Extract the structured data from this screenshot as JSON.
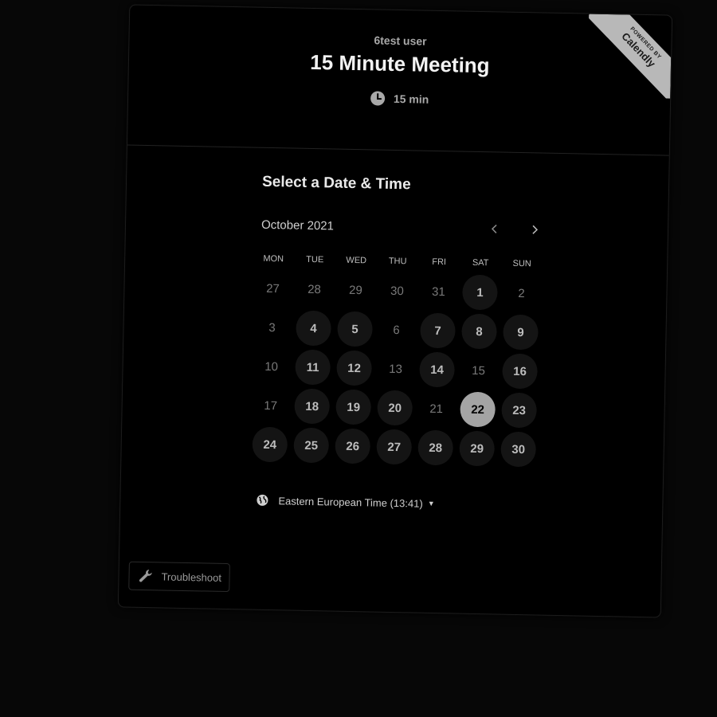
{
  "ribbon": {
    "small": "POWERED BY",
    "brand": "Calendly"
  },
  "header": {
    "owner": "6test user",
    "title": "15 Minute Meeting",
    "duration": "15 min",
    "duration_icon": "clock-icon"
  },
  "section_title": "Select a Date & Time",
  "calendar": {
    "month": "October 2021",
    "prev_icon": "chevron-left-icon",
    "next_icon": "chevron-right-icon",
    "weekdays": [
      "MON",
      "TUE",
      "WED",
      "THU",
      "FRI",
      "SAT",
      "SUN"
    ],
    "weeks": [
      [
        {
          "label": "27",
          "state": "other"
        },
        {
          "label": "28",
          "state": "other"
        },
        {
          "label": "29",
          "state": "other"
        },
        {
          "label": "30",
          "state": "other"
        },
        {
          "label": "31",
          "state": "other"
        },
        {
          "label": "1",
          "state": "available"
        },
        {
          "label": "2",
          "state": "unavailable"
        }
      ],
      [
        {
          "label": "3",
          "state": "unavailable"
        },
        {
          "label": "4",
          "state": "available"
        },
        {
          "label": "5",
          "state": "available"
        },
        {
          "label": "6",
          "state": "unavailable"
        },
        {
          "label": "7",
          "state": "available"
        },
        {
          "label": "8",
          "state": "available"
        },
        {
          "label": "9",
          "state": "available"
        }
      ],
      [
        {
          "label": "10",
          "state": "unavailable"
        },
        {
          "label": "11",
          "state": "available"
        },
        {
          "label": "12",
          "state": "available"
        },
        {
          "label": "13",
          "state": "unavailable"
        },
        {
          "label": "14",
          "state": "available"
        },
        {
          "label": "15",
          "state": "unavailable"
        },
        {
          "label": "16",
          "state": "available"
        }
      ],
      [
        {
          "label": "17",
          "state": "unavailable"
        },
        {
          "label": "18",
          "state": "available"
        },
        {
          "label": "19",
          "state": "available"
        },
        {
          "label": "20",
          "state": "available"
        },
        {
          "label": "21",
          "state": "unavailable"
        },
        {
          "label": "22",
          "state": "selected"
        },
        {
          "label": "23",
          "state": "available"
        }
      ],
      [
        {
          "label": "24",
          "state": "available"
        },
        {
          "label": "25",
          "state": "available"
        },
        {
          "label": "26",
          "state": "available"
        },
        {
          "label": "27",
          "state": "available"
        },
        {
          "label": "28",
          "state": "available"
        },
        {
          "label": "29",
          "state": "available"
        },
        {
          "label": "30",
          "state": "available"
        }
      ]
    ]
  },
  "timezone": {
    "label": "Eastern European Time (13:41)",
    "icon": "globe-icon"
  },
  "troubleshoot": {
    "label": "Troubleshoot",
    "icon": "wrench-icon"
  }
}
